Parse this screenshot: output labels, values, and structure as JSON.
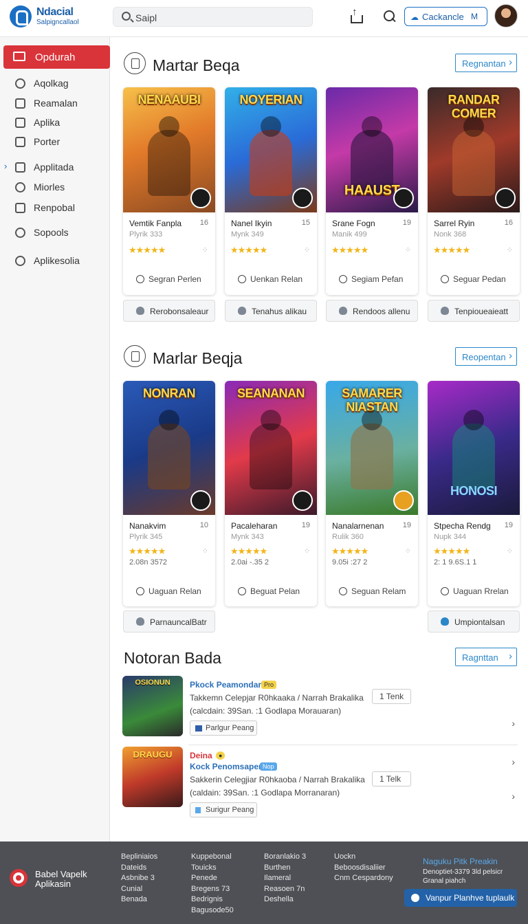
{
  "header": {
    "logo_title": "Ndacial",
    "logo_subtitle": "Salpigncallaol",
    "search_value": "Saipl",
    "account_button": "Cackancle",
    "account_tag": "M"
  },
  "sidebar": {
    "active": "Opdurah",
    "items": [
      "Aqolkag",
      "Reamalan",
      "Aplika",
      "Porter",
      "Applitada",
      "Miorles",
      "Renpobal",
      "Sopools",
      "Aplikesolia"
    ]
  },
  "sections": [
    {
      "title": "Martar Beqa",
      "more": "Regnantan",
      "cards": [
        {
          "banner": "NENAAUBI",
          "name": "Vemtik Fanpla",
          "num": "16",
          "sub": "Plyrik 333",
          "stars": "★★★★★",
          "action": "Segran Perlen",
          "pill": "Rerobonsaleaur"
        },
        {
          "banner": "NOYERIAN",
          "name": "Nanel Ikyin",
          "num": "15",
          "sub": "Mynk 349",
          "stars": "★★★★★",
          "action": "Uenkan Relan",
          "pill": "Tenahus alikau"
        },
        {
          "banner": "HAAUST",
          "name": "Srane Fogn",
          "num": "19",
          "sub": "Manik 499",
          "stars": "★★★★★",
          "action": "Segiam Pefan",
          "pill": "Rendoos allenu"
        },
        {
          "banner": "RANDAR COMER",
          "name": "Sarrel Ryin",
          "num": "16",
          "sub": "Nonk 368",
          "stars": "★★★★★",
          "action": "Seguar Pedan",
          "pill": "Tenpioueaieatt"
        }
      ]
    },
    {
      "title": "Marlar Beqja",
      "more": "Reopentan",
      "cards": [
        {
          "banner": "NONRAN",
          "name": "Nanakvim",
          "num": "10",
          "sub": "Plyrik 345",
          "stars": "★★★★★",
          "extra": "2.08n 3572",
          "action": "Uaguan Relan",
          "pill": "ParnauncalBatr"
        },
        {
          "banner": "SEANANAN",
          "name": "Pacaleharan",
          "num": "19",
          "sub": "Mynk 343",
          "stars": "★★★★★",
          "extra": "2.0ai -.35 2",
          "action": "Beguat Pelan"
        },
        {
          "banner": "SAMARER NIASTAN",
          "name": "Nanalarnenan",
          "num": "19",
          "sub": "Rulik 360",
          "stars": "★★★★★",
          "extra": "9.05i :27 2",
          "action": "Seguan Relam"
        },
        {
          "banner": "HONOSI",
          "name": "Stpecha Rendg",
          "num": "19",
          "sub": "Nupk 344",
          "stars": "★★★★★",
          "extra": "2: 1 9.6S.1 1",
          "action": "Uaguan Rrelan",
          "pill": "Umpiontalsan"
        }
      ]
    }
  ],
  "news": {
    "title": "Notoran Bada",
    "more": "Ragnttan",
    "items": [
      {
        "title": "Pkock Peamondarr",
        "tag": "Pro",
        "desc1": "Takkemn Celepjar R0hkaaka / Narrah Brakalika",
        "desc2": "(calcdain: 39San. :1 Godlapa Morauaran)",
        "count": "1 Tenk",
        "button": "Parlgur Peang",
        "banner": "OSIONUN"
      },
      {
        "title": "Kock Penomsaper",
        "prefix": "Deina",
        "tag": "Nop",
        "desc1": "Sakkerin Celegjiar R0hkaoba / Narrah Brakalika",
        "desc2": "(caldain: 39San. :1 Godlapa Morranaran)",
        "count": "1 Telk",
        "button": "Surigur Peang",
        "banner": "DRAUGU"
      }
    ]
  },
  "footer": {
    "brand": "Babel Vapelk Aplikasin",
    "col1": [
      "Bepliniaios",
      "Dateids",
      "Asbnibe 3",
      "Cunial",
      "Benada"
    ],
    "col2": [
      "Kuppebonal",
      "Touicks",
      "Penede",
      "Bregens 73",
      "Bedrignis",
      "Bagusode50"
    ],
    "col3": [
      "Boranlakio 3",
      "Burthen",
      "Ilameral",
      "Reasoen 7n",
      "Deshella"
    ],
    "col4": [
      "Uockn",
      "Beboosdisaliier",
      "Cnm Cespardony"
    ],
    "news_title": "Naguku Pitk Preakin",
    "news_text": "Denoptiet-3379 3ld pelsicr Granal piahch",
    "subscribe": "Vanpur Planhve tuplaulk"
  }
}
